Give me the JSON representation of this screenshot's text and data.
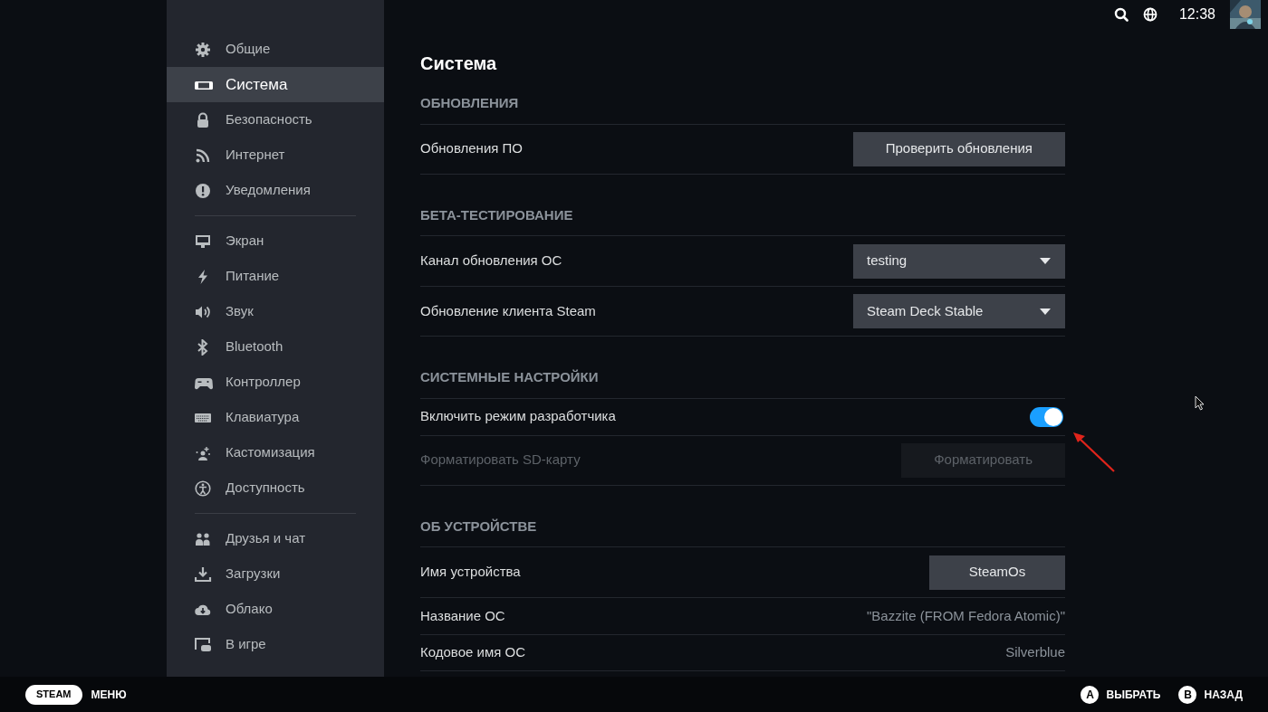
{
  "topbar": {
    "time": "12:38"
  },
  "sidebar": {
    "groups": [
      [
        {
          "label": "Общие",
          "selected": false
        },
        {
          "label": "Система",
          "selected": true
        },
        {
          "label": "Безопасность",
          "selected": false
        },
        {
          "label": "Интернет",
          "selected": false
        },
        {
          "label": "Уведомления",
          "selected": false
        }
      ],
      [
        {
          "label": "Экран",
          "selected": false
        },
        {
          "label": "Питание",
          "selected": false
        },
        {
          "label": "Звук",
          "selected": false
        },
        {
          "label": "Bluetooth",
          "selected": false
        },
        {
          "label": "Контроллер",
          "selected": false
        },
        {
          "label": "Клавиатура",
          "selected": false
        },
        {
          "label": "Кастомизация",
          "selected": false
        },
        {
          "label": "Доступность",
          "selected": false
        }
      ],
      [
        {
          "label": "Друзья и чат",
          "selected": false
        },
        {
          "label": "Загрузки",
          "selected": false
        },
        {
          "label": "Облако",
          "selected": false
        },
        {
          "label": "В игре",
          "selected": false
        }
      ]
    ]
  },
  "page": {
    "title": "Система",
    "sections": [
      {
        "heading": "ОБНОВЛЕНИЯ",
        "rows": [
          {
            "kind": "button",
            "label": "Обновления ПО",
            "button": "Проверить обновления",
            "disabled": false
          }
        ]
      },
      {
        "heading": "БЕТА-ТЕСТИРОВАНИЕ",
        "rows": [
          {
            "kind": "dropdown",
            "label": "Канал обновления ОС",
            "value": "testing"
          },
          {
            "kind": "dropdown",
            "label": "Обновление клиента Steam",
            "value": "Steam Deck Stable"
          }
        ]
      },
      {
        "heading": "СИСТЕМНЫЕ НАСТРОЙКИ",
        "rows": [
          {
            "kind": "toggle",
            "label": "Включить режим разработчика",
            "on": true
          },
          {
            "kind": "button",
            "label": "Форматировать SD-карту",
            "button": "Форматировать",
            "disabled": true
          }
        ]
      },
      {
        "heading": "ОБ УСТРОЙСТВЕ",
        "rows": [
          {
            "kind": "button",
            "label": "Имя устройства",
            "button": "SteamOs",
            "disabled": false
          },
          {
            "kind": "value",
            "label": "Название ОС",
            "value": "\"Bazzite (FROM Fedora Atomic)\""
          },
          {
            "kind": "value",
            "label": "Кодовое имя ОС",
            "value": "Silverblue"
          }
        ]
      }
    ]
  },
  "footer": {
    "steam": "STEAM",
    "menu": "МЕНЮ",
    "actions": [
      {
        "key": "A",
        "label": "ВЫБРАТЬ"
      },
      {
        "key": "B",
        "label": "НАЗАД"
      }
    ]
  }
}
